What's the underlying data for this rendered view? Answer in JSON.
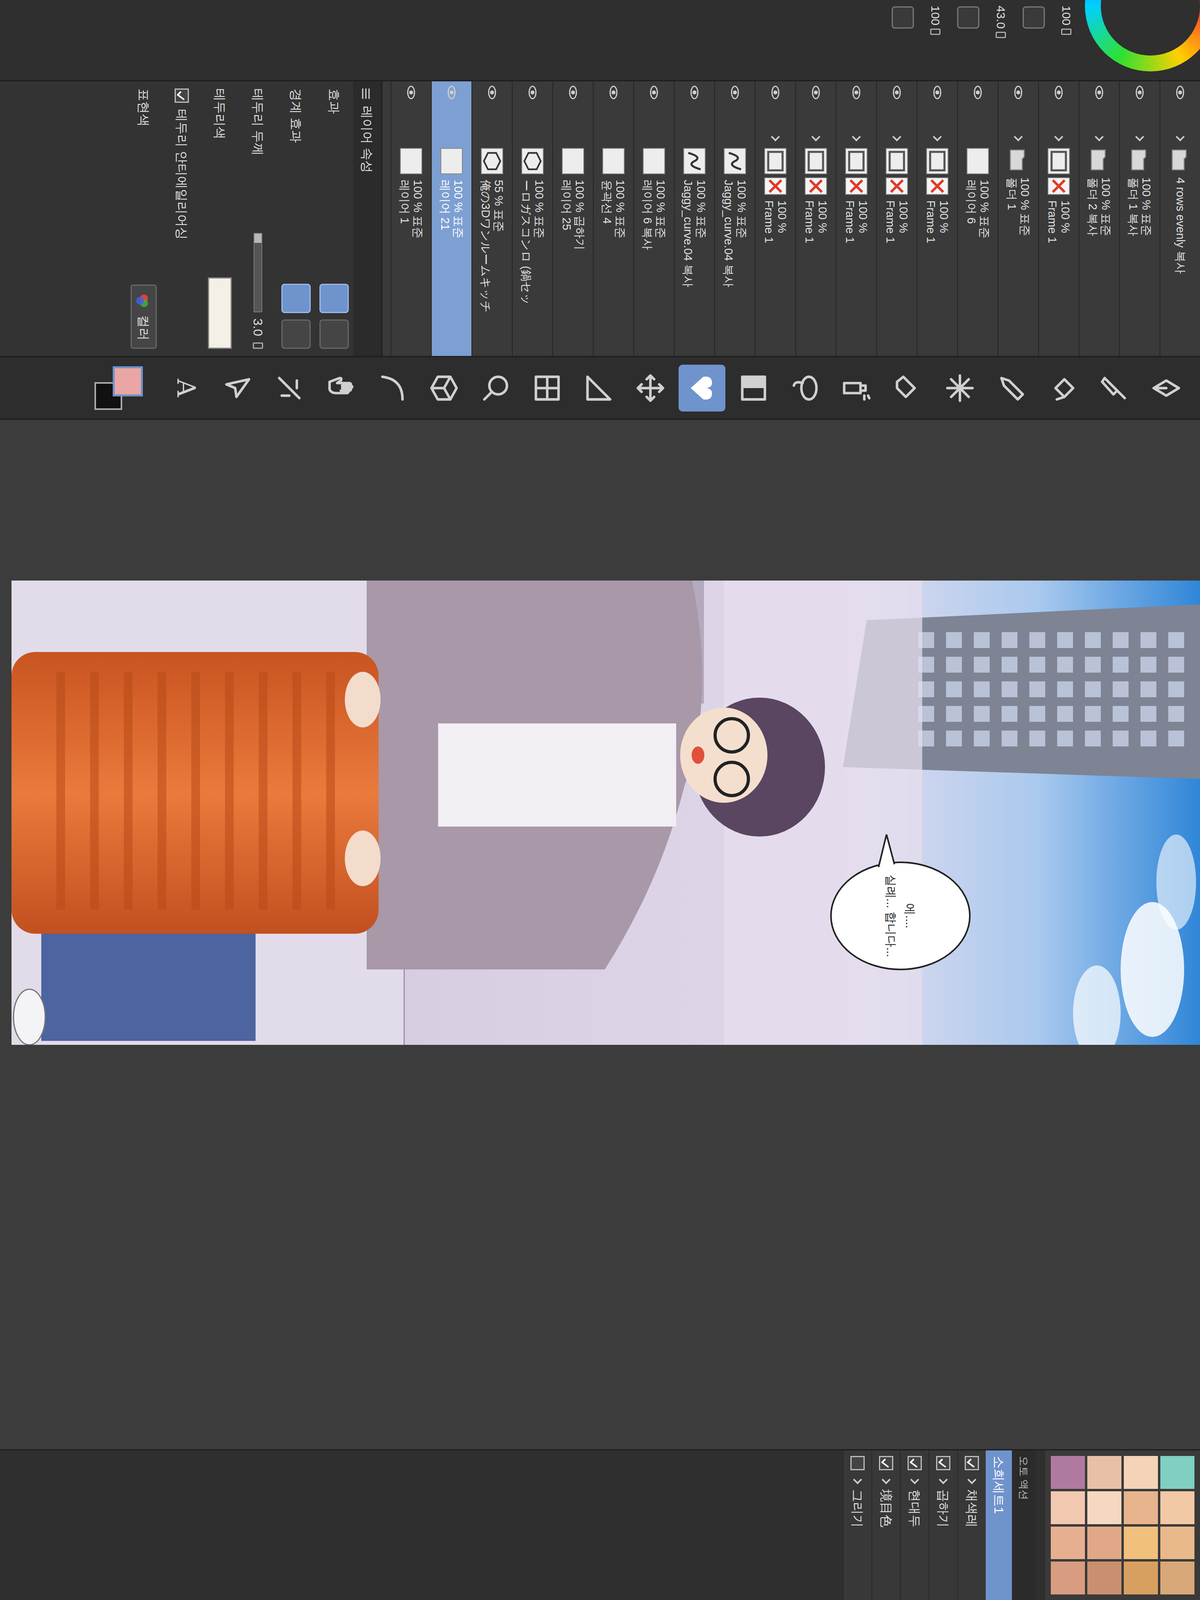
{
  "side_panel": {
    "values": [
      "100",
      "43.0",
      "100"
    ]
  },
  "layers": [
    {
      "name": "4 rows evenly 복사",
      "kind": "folder",
      "visible": true,
      "selected": false
    },
    {
      "opacity": "100 %",
      "blend": "표준",
      "name": "폴더 1 복사",
      "kind": "folder",
      "visible": true,
      "selected": false
    },
    {
      "opacity": "100 %",
      "blend": "표준",
      "name": "폴더 2 복사",
      "kind": "folder",
      "visible": true,
      "selected": false
    },
    {
      "opacity": "100 %",
      "name": "Frame 1",
      "kind": "frame",
      "visible": true,
      "selected": false
    },
    {
      "opacity": "100 %",
      "blend": "표준",
      "name": "폴더 1",
      "kind": "folder",
      "visible": true,
      "selected": false
    },
    {
      "opacity": "100 %",
      "blend": "표준",
      "name": "레이어 6",
      "kind": "raster",
      "visible": true,
      "selected": false
    },
    {
      "opacity": "100 %",
      "name": "Frame 1",
      "kind": "frame",
      "visible": true,
      "selected": false
    },
    {
      "opacity": "100 %",
      "name": "Frame 1",
      "kind": "frame",
      "visible": true,
      "selected": false
    },
    {
      "opacity": "100 %",
      "name": "Frame 1",
      "kind": "frame",
      "visible": true,
      "selected": false
    },
    {
      "opacity": "100 %",
      "name": "Frame 1",
      "kind": "frame",
      "visible": true,
      "selected": false
    },
    {
      "opacity": "100 %",
      "name": "Frame 1",
      "kind": "frame",
      "visible": true,
      "selected": false
    },
    {
      "opacity": "100 %",
      "blend": "표준",
      "name": "Jaggy_curve.04 복사",
      "kind": "vector",
      "visible": true,
      "selected": false
    },
    {
      "opacity": "100 %",
      "blend": "표준",
      "name": "Jaggy_curve.04 복사",
      "kind": "vector",
      "visible": true,
      "selected": false
    },
    {
      "opacity": "100 %",
      "blend": "표준",
      "name": "레이어 6 복사",
      "kind": "raster",
      "visible": true,
      "selected": false
    },
    {
      "opacity": "100 %",
      "blend": "표준",
      "name": "윤곽선 4",
      "kind": "raster",
      "visible": true,
      "selected": false
    },
    {
      "opacity": "100 %",
      "blend": "곱하기",
      "name": "레이어 25",
      "kind": "raster",
      "visible": true,
      "selected": false
    },
    {
      "opacity": "100 %",
      "blend": "표준",
      "name": "ーロガスコンロ (鍋セッ",
      "kind": "model",
      "visible": true,
      "selected": false
    },
    {
      "opacity": "55 %",
      "blend": "표준",
      "name": "俺の3Dワンルームキッチ",
      "kind": "model",
      "visible": true,
      "selected": false
    },
    {
      "opacity": "100 %",
      "blend": "표준",
      "name": "레이어 21",
      "kind": "raster",
      "visible": true,
      "selected": true
    },
    {
      "opacity": "100 %",
      "blend": "표준",
      "name": "레이어 1",
      "kind": "raster",
      "visible": true,
      "selected": false
    }
  ],
  "layer_properties": {
    "title": "레이어 속성",
    "section": "효과",
    "effect": "경계 효과",
    "thickness_label": "테두리 두께",
    "thickness": "3.0",
    "thickness_level": 0.12,
    "color_label": "테두리색",
    "antialias": {
      "label": "테두리 안티에일리어싱",
      "checked": true
    },
    "expression_label": "표현색",
    "expression_value": "컬러"
  },
  "tools": [
    {
      "kind": "nib",
      "selected": false
    },
    {
      "kind": "brush",
      "selected": false
    },
    {
      "kind": "bucket",
      "selected": false
    },
    {
      "kind": "pen",
      "selected": false
    },
    {
      "kind": "sparkle",
      "selected": false
    },
    {
      "kind": "eraser",
      "selected": false
    },
    {
      "kind": "spray",
      "selected": false
    },
    {
      "kind": "lasso",
      "selected": false
    },
    {
      "kind": "gradient",
      "selected": false
    },
    {
      "kind": "fill",
      "selected": true
    },
    {
      "kind": "move",
      "selected": false
    },
    {
      "kind": "ruler",
      "selected": false
    },
    {
      "kind": "frame",
      "selected": false
    },
    {
      "kind": "zoom",
      "selected": false
    },
    {
      "kind": "cube",
      "selected": false
    },
    {
      "kind": "curve",
      "selected": false
    },
    {
      "kind": "hand",
      "selected": false
    },
    {
      "kind": "select",
      "selected": false
    },
    {
      "kind": "arrow",
      "selected": false
    },
    {
      "kind": "text",
      "label": "A",
      "selected": false
    }
  ],
  "colors": {
    "main": "#eaa6a2",
    "sub": "#111111"
  },
  "canvas": {
    "bubble": [
      "에....",
      "실례... 합니다..."
    ]
  },
  "palette": [
    {
      "color": "#7fcfc3"
    },
    {
      "color": "#f1c9a5"
    },
    {
      "color": "#e9b98c"
    },
    {
      "color": "#d9a878"
    },
    {
      "color": "#f4d3b8"
    },
    {
      "color": "#e8b48e"
    },
    {
      "color": "#f0c07c"
    },
    {
      "color": "#d8a060"
    },
    {
      "color": "#e8c0a8"
    },
    {
      "color": "#f6d8c0"
    },
    {
      "color": "#e0a888"
    },
    {
      "color": "#c89070"
    },
    {
      "color": "#b07aa0"
    },
    {
      "color": "#f2c8b0"
    },
    {
      "color": "#e6b090"
    },
    {
      "color": "#d89c80"
    }
  ],
  "auto_action": {
    "title": "오토 액션",
    "set": "소희세트1",
    "items": [
      {
        "label": "채색레",
        "checked": true
      },
      {
        "label": "곱하기",
        "checked": true
      },
      {
        "label": "현대두",
        "checked": true
      },
      {
        "label": "境目色",
        "checked": true
      },
      {
        "label": "그리기",
        "checked": false
      }
    ]
  }
}
